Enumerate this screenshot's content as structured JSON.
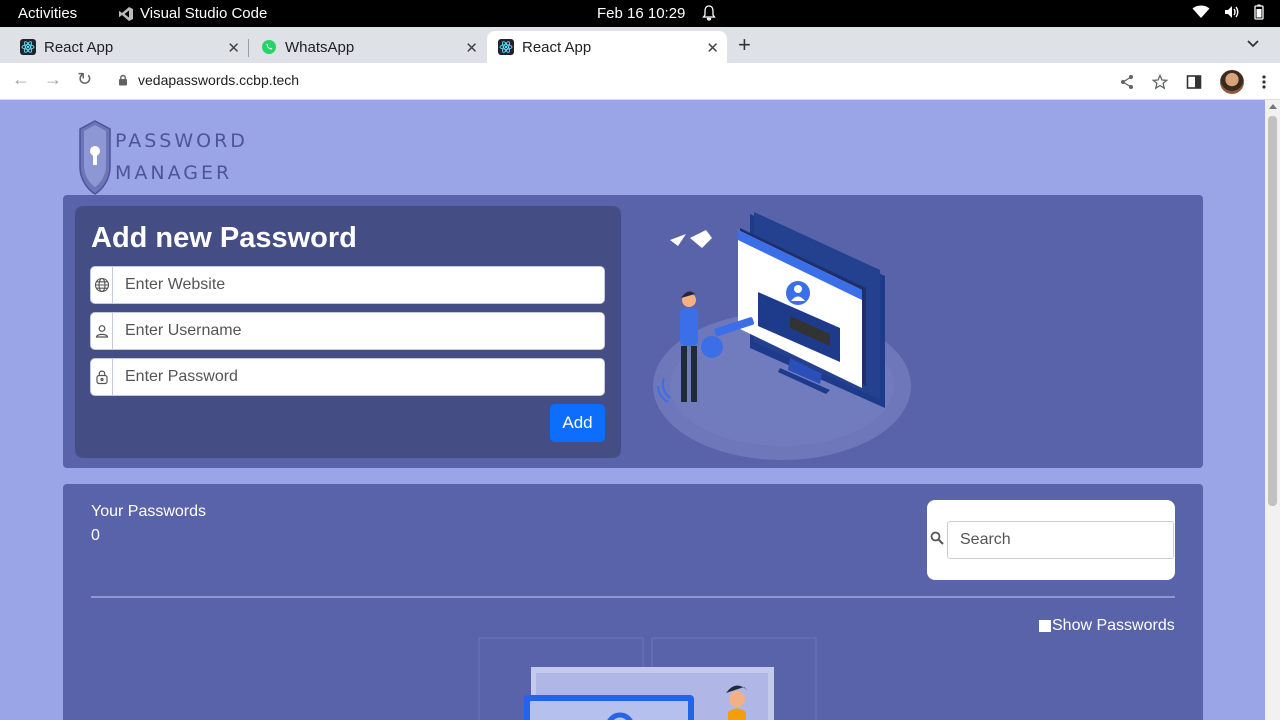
{
  "os_topbar": {
    "activities": "Activities",
    "app_name": "Visual Studio Code",
    "clock": "Feb 16  10:29"
  },
  "browser": {
    "tabs": [
      {
        "label": "React App",
        "icon": "react-icon"
      },
      {
        "label": "WhatsApp",
        "icon": "whatsapp-icon"
      },
      {
        "label": "React App",
        "icon": "react-icon",
        "active": true
      }
    ],
    "url": "vedapasswords.ccbp.tech"
  },
  "app": {
    "logo_line1": "PASSWORD",
    "logo_line2": "MANAGER",
    "form": {
      "title": "Add new Password",
      "website_placeholder": "Enter Website",
      "username_placeholder": "Enter Username",
      "password_placeholder": "Enter Password",
      "add_label": "Add"
    },
    "list": {
      "heading": "Your Passwords",
      "count": "0",
      "search_placeholder": "Search",
      "show_passwords_label": "Show Passwords"
    }
  },
  "colors": {
    "page_bg": "#9aa5e8",
    "panel_bg": "#5963a9",
    "form_card_bg": "#454e84",
    "button_blue": "#0d6efd"
  }
}
